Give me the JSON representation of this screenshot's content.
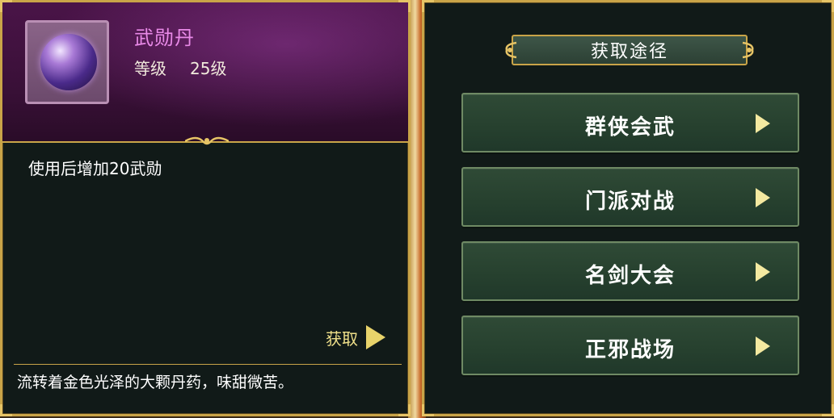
{
  "item": {
    "name": "武勋丹",
    "level_label": "等级",
    "level_value": "25级",
    "icon": "purple-orb-icon",
    "effect": "使用后增加20武勋",
    "obtain_label": "获取",
    "description": "流转着金色光泽的大颗丹药，味甜微苦。"
  },
  "sources": {
    "title": "获取途径",
    "buttons": [
      {
        "label": "群侠会武"
      },
      {
        "label": "门派对战"
      },
      {
        "label": "名剑大会"
      },
      {
        "label": "正邪战场"
      }
    ]
  },
  "colors": {
    "border_gold": "#c9a448",
    "item_name_pink": "#e98ae8",
    "button_green": "#2f4a36",
    "arrow_yellow": "#e8d36a"
  }
}
